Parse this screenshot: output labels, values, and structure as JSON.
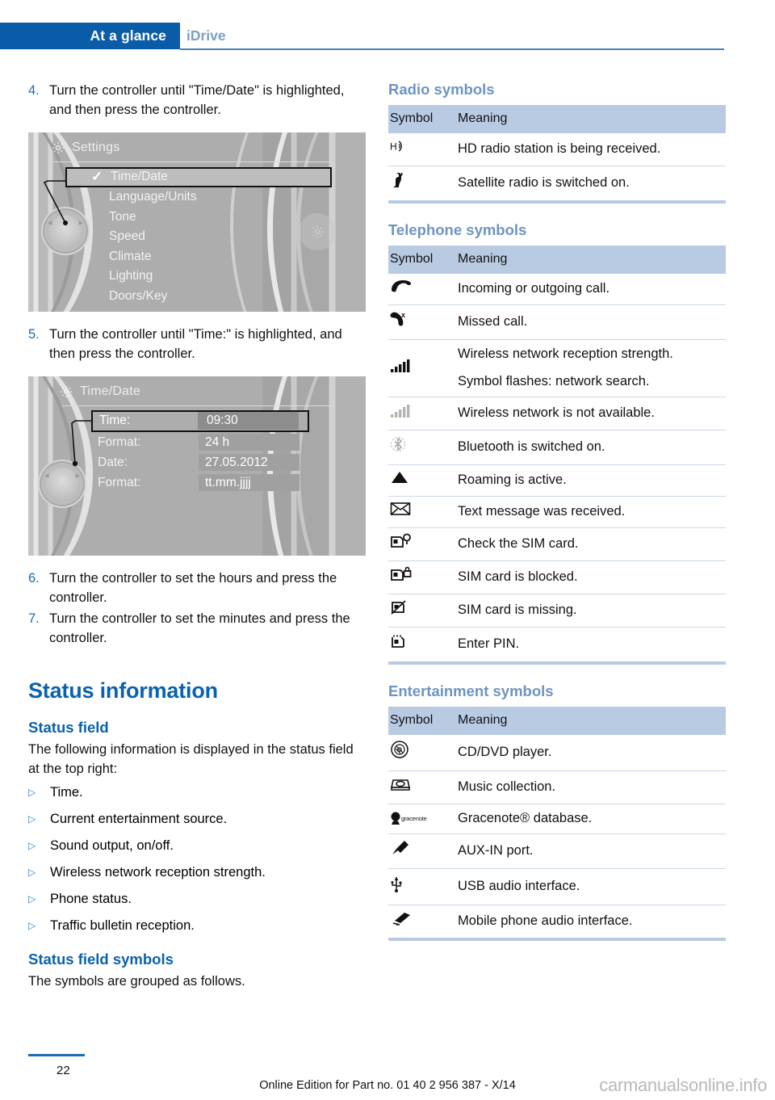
{
  "header": {
    "active_tab": "At a glance",
    "inactive_tab": "iDrive"
  },
  "left_column": {
    "steps_top": [
      {
        "num": "4.",
        "text": "Turn the controller until \"Time/Date\" is highlighted, and then press the controller."
      }
    ],
    "illustration_settings": {
      "title": "Settings",
      "gear_icon": "gear-icon",
      "items": [
        {
          "label": "Time/Date",
          "selected": true,
          "checked": true
        },
        {
          "label": "Language/Units",
          "selected": false,
          "checked": false
        },
        {
          "label": "Tone",
          "selected": false,
          "checked": false
        },
        {
          "label": "Speed",
          "selected": false,
          "checked": false
        },
        {
          "label": "Climate",
          "selected": false,
          "checked": false
        },
        {
          "label": "Lighting",
          "selected": false,
          "checked": false
        },
        {
          "label": "Doors/Key",
          "selected": false,
          "checked": false
        }
      ]
    },
    "steps_mid": [
      {
        "num": "5.",
        "text": "Turn the controller until \"Time:\" is highlighted, and then press the controller."
      }
    ],
    "illustration_timedate": {
      "title": "Time/Date",
      "gear_icon": "gear-icon",
      "rows": [
        {
          "label": "Time:",
          "value": "09:30",
          "selected": true
        },
        {
          "label": "Format:",
          "value": "24 h",
          "selected": false
        },
        {
          "label": "Date:",
          "value": "27.05.2012",
          "selected": false
        },
        {
          "label": "Format:",
          "value": "tt.mm.jjjj",
          "selected": false
        }
      ]
    },
    "steps_bottom": [
      {
        "num": "6.",
        "text": "Turn the controller to set the hours and press the controller."
      },
      {
        "num": "7.",
        "text": "Turn the controller to set the minutes and press the controller."
      }
    ],
    "status_information_heading": "Status information",
    "status_field_heading": "Status field",
    "status_field_intro": "The following information is displayed in the status field at the top right:",
    "status_field_bullets": [
      "Time.",
      "Current entertainment source.",
      "Sound output, on/off.",
      "Wireless network reception strength.",
      "Phone status.",
      "Traffic bulletin reception."
    ],
    "status_field_symbols_heading": "Status field symbols",
    "status_field_symbols_intro": "The symbols are grouped as follows."
  },
  "right_column": {
    "radio": {
      "heading": "Radio symbols",
      "columns": [
        "Symbol",
        "Meaning"
      ],
      "rows": [
        {
          "icon": "hd-radio-icon",
          "meaning": "HD radio station is being received."
        },
        {
          "icon": "satellite-radio-icon",
          "meaning": "Satellite radio is switched on."
        }
      ]
    },
    "telephone": {
      "heading": "Telephone symbols",
      "columns": [
        "Symbol",
        "Meaning"
      ],
      "rows": [
        {
          "icon": "phone-handset-icon",
          "meaning": "Incoming or outgoing call."
        },
        {
          "icon": "missed-call-icon",
          "meaning": "Missed call."
        },
        {
          "icon": "signal-bars-icon",
          "meaning": "Wireless network reception strength.",
          "meaning2": "Symbol flashes: network search."
        },
        {
          "icon": "signal-bars-grey-icon",
          "meaning": "Wireless network is not available."
        },
        {
          "icon": "bluetooth-icon",
          "meaning": "Bluetooth is switched on."
        },
        {
          "icon": "roaming-triangle-icon",
          "meaning": "Roaming is active."
        },
        {
          "icon": "envelope-icon",
          "meaning": "Text message was received."
        },
        {
          "icon": "sim-check-icon",
          "meaning": "Check the SIM card."
        },
        {
          "icon": "sim-blocked-icon",
          "meaning": "SIM card is blocked."
        },
        {
          "icon": "sim-missing-icon",
          "meaning": "SIM card is missing."
        },
        {
          "icon": "enter-pin-icon",
          "meaning": "Enter PIN."
        }
      ]
    },
    "entertainment": {
      "heading": "Entertainment symbols",
      "columns": [
        "Symbol",
        "Meaning"
      ],
      "rows": [
        {
          "icon": "cd-dvd-icon",
          "meaning": "CD/DVD player."
        },
        {
          "icon": "music-collection-icon",
          "meaning": "Music collection."
        },
        {
          "icon": "gracenote-icon",
          "icon_text": "gracenote",
          "meaning": "Gracenote® database."
        },
        {
          "icon": "aux-in-icon",
          "meaning": "AUX-IN port."
        },
        {
          "icon": "usb-icon",
          "meaning": "USB audio interface."
        },
        {
          "icon": "mobile-audio-icon",
          "meaning": "Mobile phone audio interface."
        }
      ]
    }
  },
  "footer": {
    "page_number": "22",
    "edition": "Online Edition for Part no. 01 40 2 956 387 - X/14",
    "watermark": "carmanualsonline.info"
  },
  "colors": {
    "brand_blue": "#0a5ca8",
    "heading_blue": "#0a62ae",
    "table_header_blue": "#b9cbe3",
    "muted_heading_blue": "#6e94c2"
  }
}
